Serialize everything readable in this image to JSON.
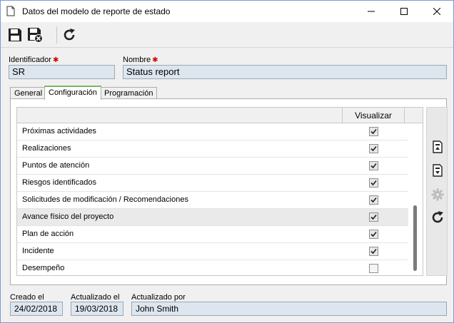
{
  "window": {
    "title": "Datos del modelo de reporte de estado",
    "controls": [
      "minimize",
      "maximize",
      "close"
    ]
  },
  "toolbar": {
    "buttons": [
      "save-icon",
      "save-and-close-icon",
      "refresh-icon"
    ]
  },
  "header": {
    "identificador_label": "Identificador",
    "identificador_value": "SR",
    "nombre_label": "Nombre",
    "nombre_value": "Status report",
    "required_marker": "✱"
  },
  "tabs": [
    {
      "label": "General",
      "active": false
    },
    {
      "label": "Configuración",
      "active": true
    },
    {
      "label": "Programación",
      "active": false
    }
  ],
  "grid": {
    "columns": [
      "",
      "Visualizar"
    ],
    "rows": [
      {
        "label": "Próximas actividades",
        "visualizar": true
      },
      {
        "label": "Realizaciones",
        "visualizar": true
      },
      {
        "label": "Puntos de atención",
        "visualizar": true
      },
      {
        "label": "Riesgos identificados",
        "visualizar": true
      },
      {
        "label": "Solicitudes de modificación / Recomendaciones",
        "visualizar": true
      },
      {
        "label": "Avance físico del proyecto",
        "visualizar": true,
        "selected": true
      },
      {
        "label": "Plan de acción",
        "visualizar": true
      },
      {
        "label": "Incidente",
        "visualizar": true
      },
      {
        "label": "Desempeño",
        "visualizar": false
      }
    ],
    "side_buttons": [
      "move-up-icon",
      "move-down-icon",
      "settings-icon",
      "refresh-icon"
    ]
  },
  "footer": {
    "creado_label": "Creado el",
    "creado_value": "24/02/2018",
    "actualizado_label": "Actualizado el",
    "actualizado_value": "19/03/2018",
    "actualizado_por_label": "Actualizado por",
    "actualizado_por_value": "John Smith"
  },
  "colors": {
    "active_tab_accent": "#7ab85c",
    "field_bg": "#dde6ee",
    "required": "#d10000"
  }
}
